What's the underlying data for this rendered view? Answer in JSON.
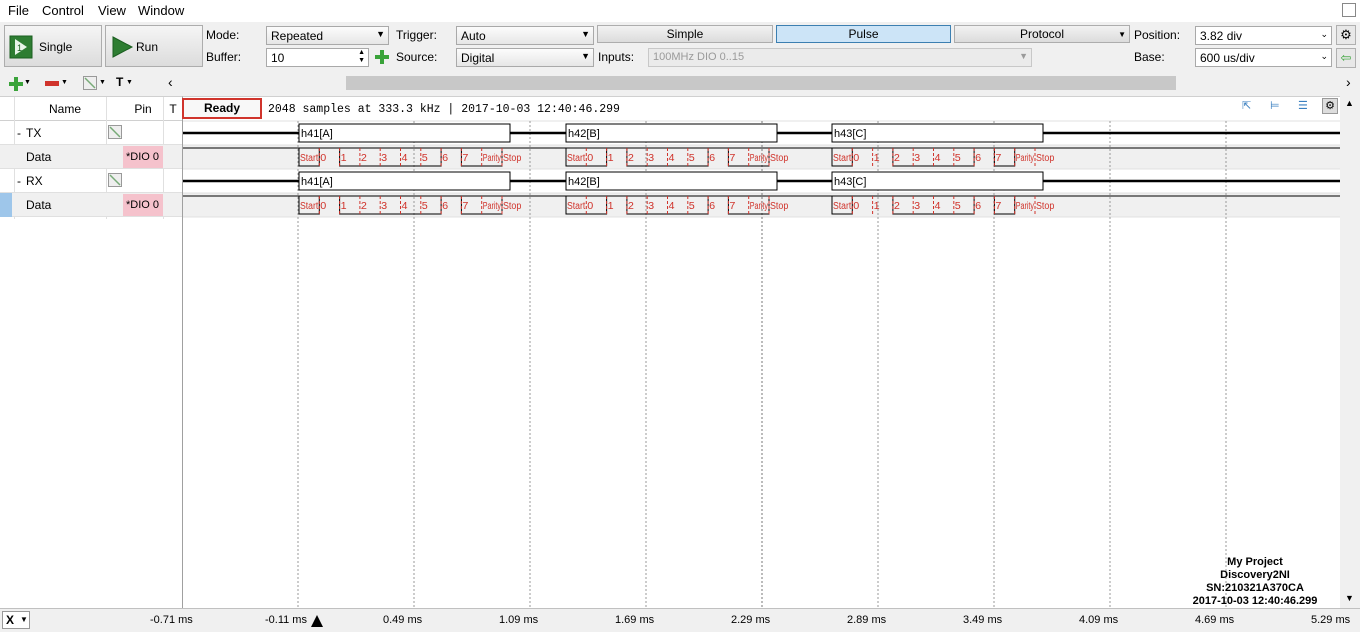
{
  "menu": [
    "File",
    "Control",
    "View",
    "Window"
  ],
  "toolbar": {
    "single_label": "Single",
    "run_label": "Run",
    "mode_label": "Mode:",
    "mode_value": "Repeated",
    "buffer_label": "Buffer:",
    "buffer_value": "10",
    "trigger_label": "Trigger:",
    "trigger_value": "Auto",
    "source_label": "Source:",
    "source_value": "Digital",
    "tabs": [
      "Simple",
      "Pulse",
      "Protocol"
    ],
    "inputs_label": "Inputs:",
    "inputs_value": "100MHz DIO 0..15",
    "position_label": "Position:",
    "position_value": "3.82 div",
    "base_label": "Base:",
    "base_value": "600 us/div"
  },
  "channels": {
    "header_name": "Name",
    "header_pin": "Pin",
    "header_t": "T",
    "rows": [
      {
        "name": "TX",
        "collapse": "-",
        "pin": ""
      },
      {
        "name": "Data",
        "collapse": "",
        "pin": "*DIO 0"
      },
      {
        "name": "RX",
        "collapse": "-",
        "pin": ""
      },
      {
        "name": "Data",
        "collapse": "",
        "pin": "*DIO 0"
      }
    ]
  },
  "status": {
    "state": "Ready",
    "info": "2048 samples at 333.3 kHz | 2017-10-03 12:40:46.299"
  },
  "frames": [
    {
      "label": "h41[A]",
      "bits": [
        1,
        0,
        0,
        0,
        0,
        0,
        1,
        0,
        0,
        1
      ]
    },
    {
      "label": "h42[B]",
      "bits": [
        0,
        1,
        0,
        0,
        0,
        0,
        1,
        0,
        0,
        1
      ]
    },
    {
      "label": "h43[C]",
      "bits": [
        1,
        1,
        0,
        0,
        0,
        0,
        1,
        0,
        1,
        1
      ]
    }
  ],
  "bit_labels": [
    "Start",
    "0",
    "1",
    "2",
    "3",
    "4",
    "5",
    "6",
    "7",
    "Parity",
    "Stop"
  ],
  "time_axis": {
    "x_label": "X",
    "ticks": [
      "-0.71 ms",
      "-0.11 ms",
      "0.49 ms",
      "1.09 ms",
      "1.69 ms",
      "2.29 ms",
      "2.89 ms",
      "3.49 ms",
      "4.09 ms",
      "4.69 ms",
      "5.29 ms"
    ]
  },
  "device": {
    "project": "My Project",
    "model": "Discovery2NI",
    "serial": "SN:210321A370CA",
    "timestamp": "2017-10-03 12:40:46.299"
  },
  "colors": {
    "accent": "#d0342c",
    "active_tab": "#cce4f7",
    "pin_bg": "#f5c2cc",
    "grid": "#888888"
  }
}
